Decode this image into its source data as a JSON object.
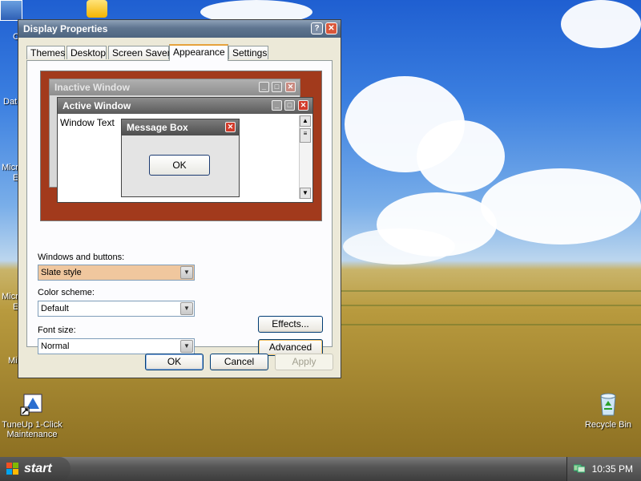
{
  "window": {
    "title": "Display Properties",
    "help_label": "?",
    "close_label": "✕"
  },
  "tabs": [
    {
      "label": "Themes"
    },
    {
      "label": "Desktop"
    },
    {
      "label": "Screen Saver"
    },
    {
      "label": "Appearance",
      "active": true
    },
    {
      "label": "Settings"
    }
  ],
  "preview": {
    "inactive_title": "Inactive Window",
    "active_title": "Active Window",
    "window_text": "Window Text",
    "message_title": "Message Box",
    "message_ok": "OK"
  },
  "controls": {
    "windows_buttons_label": "Windows and buttons:",
    "windows_buttons_value": "Slate style",
    "color_scheme_label": "Color scheme:",
    "color_scheme_value": "Default",
    "font_size_label": "Font size:",
    "font_size_value": "Normal",
    "effects_label": "Effects...",
    "advanced_label": "Advanced"
  },
  "footer": {
    "ok_label": "OK",
    "cancel_label": "Cancel",
    "apply_label": "Apply"
  },
  "desktop_icons": {
    "tuneup": "TuneUp 1-Click Maintenance",
    "recycle": "Recycle Bin"
  },
  "desktop_clipped": {
    "dat": "Dat",
    "micr1": "Micr",
    "e1": "E",
    "micr2": "Micr",
    "e2": "E",
    "mi": "Mi",
    "c": "C"
  },
  "taskbar": {
    "start_label": "start",
    "clock": "10:35 PM"
  },
  "colors": {
    "preview_background": "#a23a1c",
    "selected_combo": "#f0c79e",
    "active_tab_accent": "#e6a23c"
  }
}
